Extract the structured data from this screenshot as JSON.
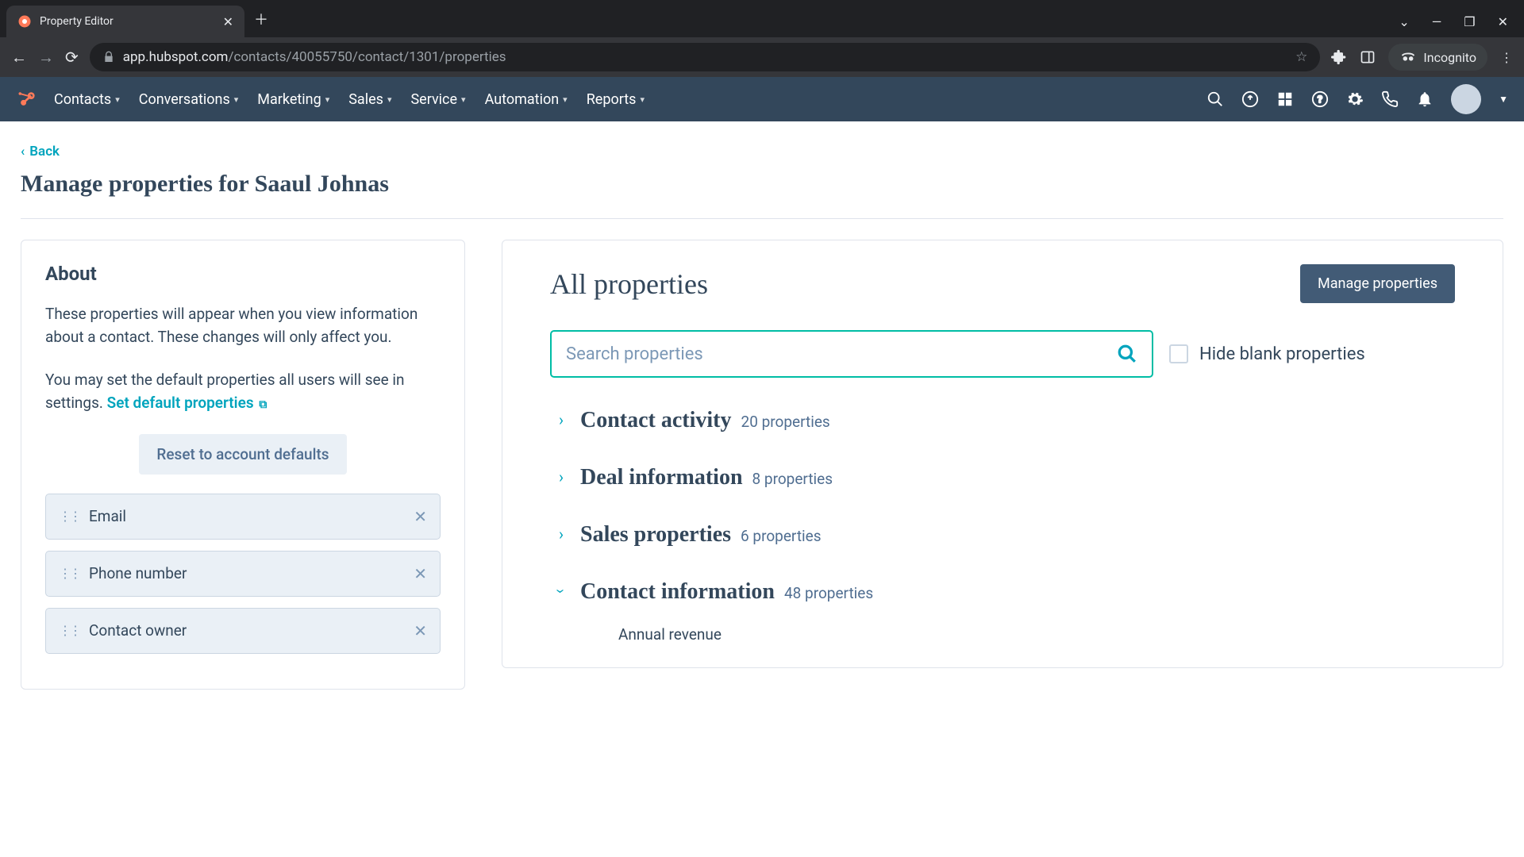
{
  "browser": {
    "tab_title": "Property Editor",
    "url_host": "app.hubspot.com",
    "url_path": "/contacts/40055750/contact/1301/properties",
    "incognito_label": "Incognito"
  },
  "nav": {
    "items": [
      "Contacts",
      "Conversations",
      "Marketing",
      "Sales",
      "Service",
      "Automation",
      "Reports"
    ]
  },
  "page": {
    "back_label": "Back",
    "title": "Manage properties for Saaul Johnas"
  },
  "about": {
    "title": "About",
    "p1": "These properties will appear when you view information about a contact. These changes will only affect you.",
    "p2_prefix": "You may set the default properties all users will see in settings. ",
    "link_label": "Set default properties",
    "reset_label": "Reset to account defaults",
    "pills": [
      "Email",
      "Phone number",
      "Contact owner"
    ]
  },
  "main": {
    "title": "All properties",
    "manage_label": "Manage properties",
    "search_placeholder": "Search properties",
    "hide_blank_label": "Hide blank properties",
    "groups": [
      {
        "name": "Contact activity",
        "count": "20 properties",
        "open": false
      },
      {
        "name": "Deal information",
        "count": "8 properties",
        "open": false
      },
      {
        "name": "Sales properties",
        "count": "6 properties",
        "open": false
      },
      {
        "name": "Contact information",
        "count": "48 properties",
        "open": true,
        "items": [
          "Annual revenue"
        ]
      }
    ]
  }
}
